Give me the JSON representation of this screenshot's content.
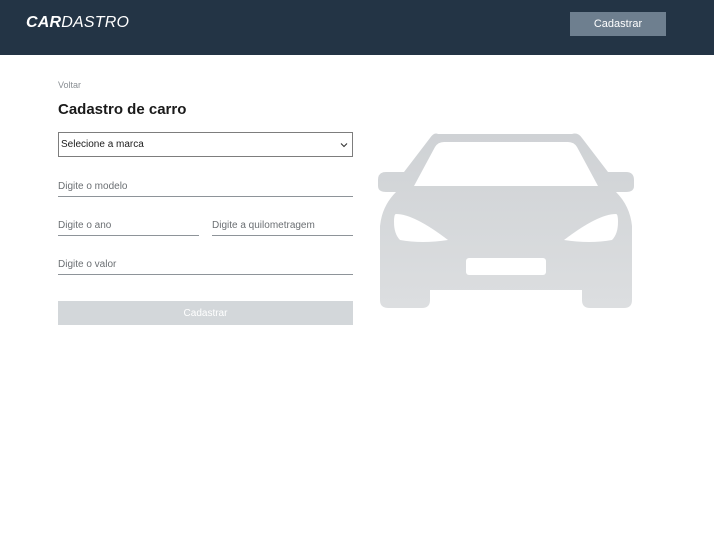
{
  "header": {
    "logo_bold": "CAR",
    "logo_light": "DASTRO",
    "nav_button_label": "Cadastrar",
    "background_color": "#233445",
    "button_color": "#6e7f8f"
  },
  "form": {
    "back_label": "Voltar",
    "title": "Cadastro de carro",
    "brand_select_value": "Selecione a marca",
    "model_placeholder": "Digite o modelo",
    "year_placeholder": "Digite o ano",
    "mileage_placeholder": "Digite a quilometragem",
    "value_placeholder": "Digite o valor",
    "submit_label": "Cadastrar",
    "submit_color": "#d3d7da"
  },
  "illustration": {
    "icon": "car-icon",
    "color": "#d3d6d9"
  }
}
